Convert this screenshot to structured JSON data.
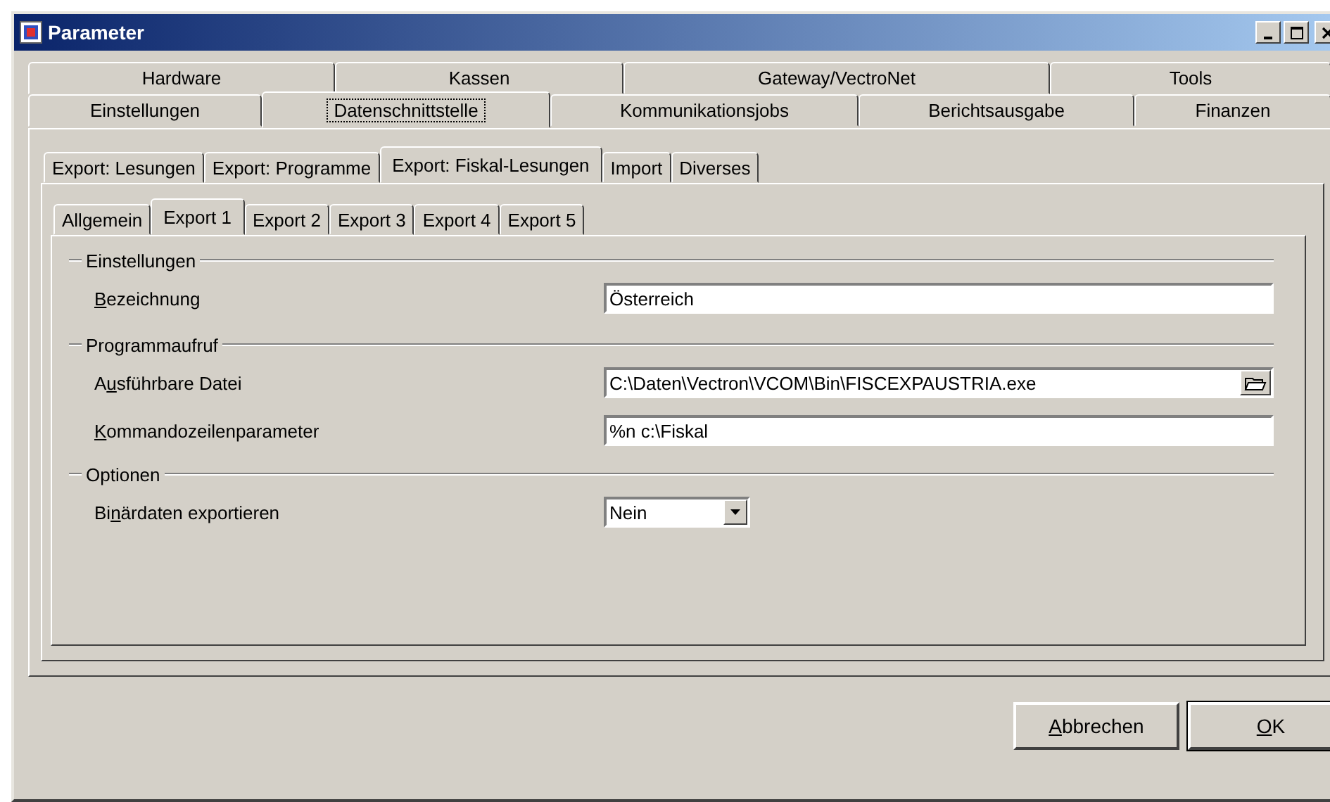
{
  "window": {
    "title": "Parameter"
  },
  "tab_rows": [
    [
      {
        "label": "Hardware",
        "selected": false
      },
      {
        "label": "Kassen",
        "selected": false
      },
      {
        "label": "Gateway/VectroNet",
        "selected": false
      },
      {
        "label": "Tools",
        "selected": false
      }
    ],
    [
      {
        "label": "Einstellungen",
        "selected": false
      },
      {
        "label": "Datenschnittstelle",
        "selected": true
      },
      {
        "label": "Kommunikationsjobs",
        "selected": false
      },
      {
        "label": "Berichtsausgabe",
        "selected": false
      },
      {
        "label": "Finanzen",
        "selected": false
      }
    ]
  ],
  "export_tabs": [
    {
      "label": "Export: Lesungen",
      "selected": false
    },
    {
      "label": "Export: Programme",
      "selected": false
    },
    {
      "label": "Export: Fiskal-Lesungen",
      "selected": true
    },
    {
      "label": "Import",
      "selected": false
    },
    {
      "label": "Diverses",
      "selected": false
    }
  ],
  "sub_tabs": [
    {
      "label": "Allgemein",
      "selected": false
    },
    {
      "label": "Export 1",
      "selected": true
    },
    {
      "label": "Export 2",
      "selected": false
    },
    {
      "label": "Export 3",
      "selected": false
    },
    {
      "label": "Export 4",
      "selected": false
    },
    {
      "label": "Export 5",
      "selected": false
    }
  ],
  "groups": [
    {
      "title": "Einstellungen",
      "fields": [
        {
          "kind": "text",
          "access_key": "B",
          "label_after": "ezeichnung",
          "value": "Österreich"
        }
      ]
    },
    {
      "title": "Programmaufruf",
      "fields": [
        {
          "kind": "file",
          "label_before": "A",
          "access_key": "u",
          "label_after": "sführbare Datei",
          "value": "C:\\Daten\\Vectron\\VCOM\\Bin\\FISCEXPAUSTRIA.exe"
        },
        {
          "kind": "text",
          "access_key": "K",
          "label_after": "ommandozeilenparameter",
          "value": "%n c:\\Fiskal"
        }
      ]
    },
    {
      "title": "Optionen",
      "fields": [
        {
          "kind": "select",
          "label_before": "Bi",
          "access_key": "n",
          "label_after": "ärdaten exportieren",
          "value": "Nein"
        }
      ]
    }
  ],
  "buttons": [
    {
      "access_key": "A",
      "label_after": "bbrechen"
    },
    {
      "access_key": "O",
      "label_after": "K"
    }
  ]
}
